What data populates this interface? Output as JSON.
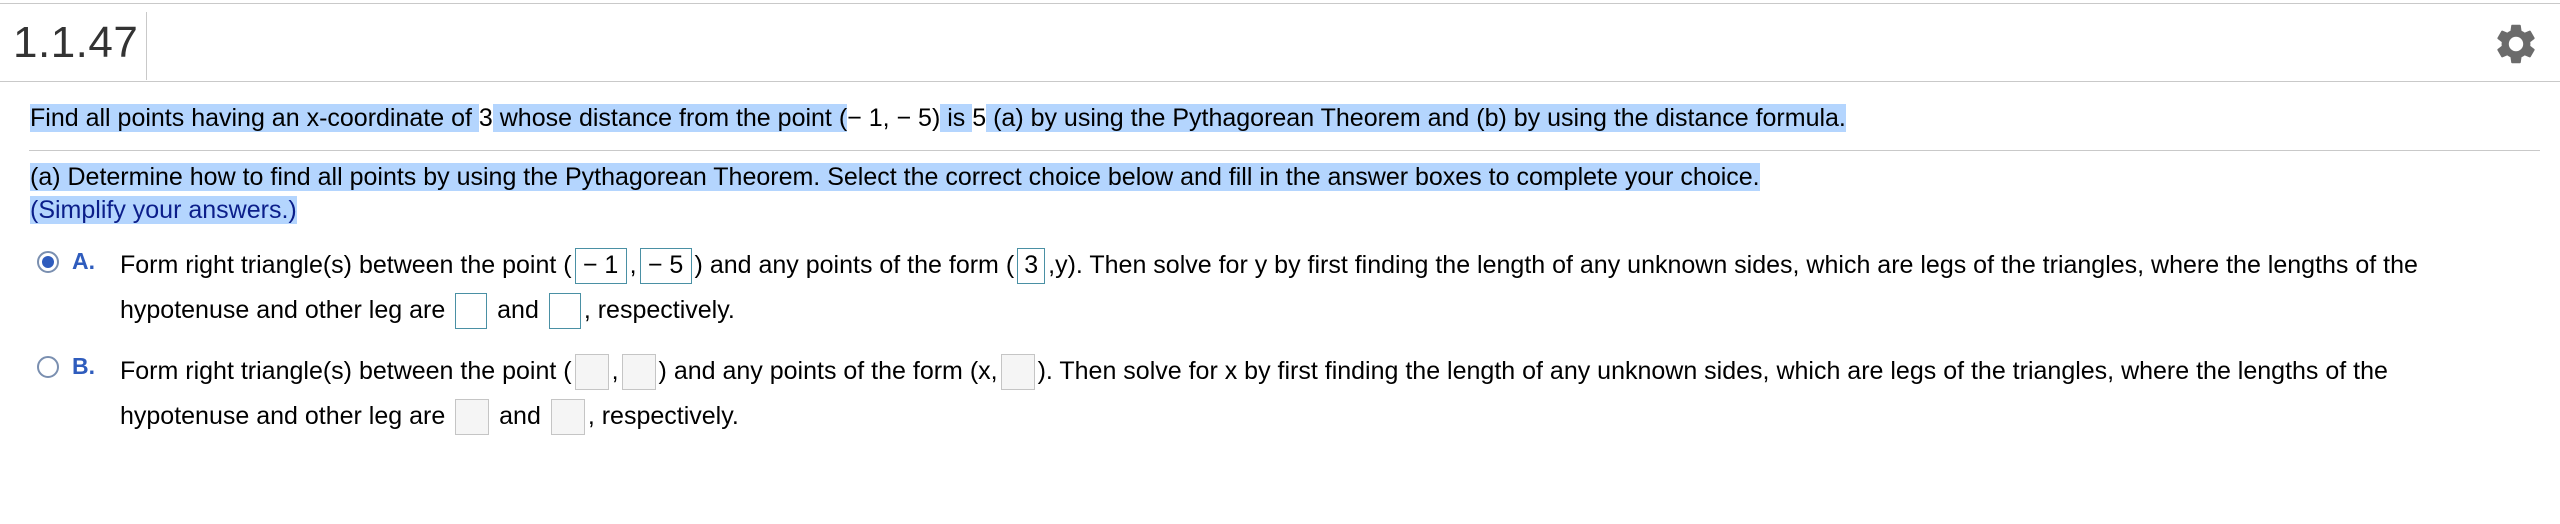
{
  "header": {
    "question_number": "1.1.47",
    "settings_icon": "gear-icon"
  },
  "prompt": {
    "p1": "Find all points having an x-coordinate of ",
    "x": "3",
    "p2": " whose distance from the point (",
    "pt": "− 1, − 5)",
    "p3": " is ",
    "d": "5",
    "p4": " (a) by using the Pythagorean Theorem and (b) by using the distance formula."
  },
  "part_a": {
    "instruction": "(a) Determine how to find all points by using the Pythagorean Theorem. Select the correct choice below and fill in the answer boxes to complete your choice.",
    "simplify": "(Simplify your answers.)"
  },
  "choice_a": {
    "letter": "A.",
    "selected": true,
    "t1": "Form right triangle(s) between the point (",
    "v1": "− 1",
    "comma": ",",
    "v2": "− 5",
    "t2": ") and any points of the form (",
    "v3": "3",
    "t3": ",y). Then solve for y by first finding the length of any unknown sides, which are legs of the triangles, where the lengths of the",
    "t4": "hypotenuse and other leg are",
    "and": "and",
    "t5": ", respectively."
  },
  "choice_b": {
    "letter": "B.",
    "selected": false,
    "t1": "Form right triangle(s) between the point (",
    "comma": ",",
    "t2": ") and any points of the form (x,",
    "t3": "). Then solve for x by first finding the length of any unknown sides, which are legs of the triangles, where the lengths of the",
    "t4": "hypotenuse and other leg are",
    "and": "and",
    "t5": ", respectively."
  }
}
